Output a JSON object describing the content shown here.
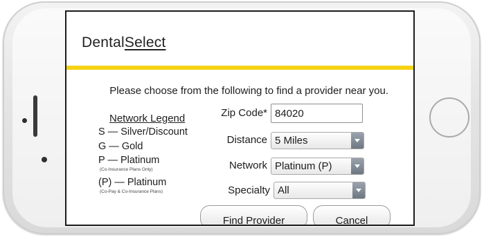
{
  "brand": {
    "part1": "Dental",
    "part2": "Select"
  },
  "intro": "Please choose from the following to find a provider near you.",
  "legend": {
    "title": "Network Legend",
    "silver": "S — Silver/Discount",
    "gold": "G — Gold",
    "platinum": "P — Platinum",
    "platinum_note": "(Co-Insurance Plans Only)",
    "platinum_p": "(P) — Platinum",
    "platinum_p_note": "(Co-Pay & Co-Insurance Plans)"
  },
  "form": {
    "zip_label": "Zip Code*",
    "zip_value": "84020",
    "distance_label": "Distance",
    "distance_value": "5 Miles",
    "network_label": "Network",
    "network_value": "Platinum (P)",
    "specialty_label": "Specialty",
    "specialty_value": "All"
  },
  "buttons": {
    "find": "Find Provider",
    "cancel": "Cancel"
  },
  "colors": {
    "accent_bar": "#f5d314"
  }
}
